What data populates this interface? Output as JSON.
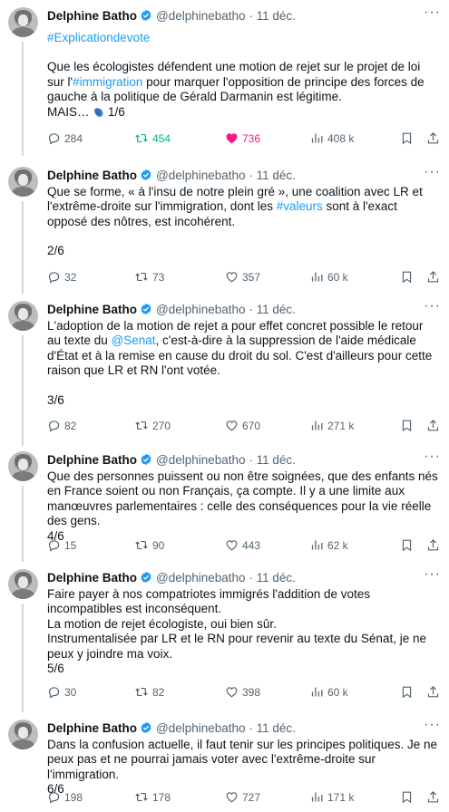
{
  "author": {
    "name": "Delphine Batho",
    "handle": "@delphinebatho",
    "date": "· 11 déc."
  },
  "colors": {
    "link": "#1d9bf0",
    "verified": "#1d9bf0",
    "retweet_active": "#00ba7c",
    "like_active": "#f91880",
    "secondary": "#536471"
  },
  "tweets": [
    {
      "hashtag": "#Explicationdevote",
      "text_a": "Que les écologistes défendent une motion de rejet sur le projet de loi sur l'",
      "link_a": "#immigration",
      "text_b": " pour marquer l'opposition de principe des forces de gauche à la politique de Gérald Darmanin est légitime.",
      "text_c": "MAIS…",
      "text_d": " 1/6",
      "replies": "284",
      "retweets": "454",
      "likes": "736",
      "views": "408 k"
    },
    {
      "text_a": "Que se forme, « à l'insu de notre plein gré », une coalition avec LR et l'extrême-droite sur l'immigration, dont les ",
      "link_a": "#valeurs",
      "text_b": " sont à l'exact opposé des nôtres, est incohérent.",
      "counter": "2/6",
      "replies": "32",
      "retweets": "73",
      "likes": "357",
      "views": "60 k"
    },
    {
      "text_a": "L'adoption de la motion de rejet a pour effet concret possible le retour au texte du ",
      "link_a": "@Senat",
      "text_b": ", c'est-à-dire à la suppression de l'aide médicale d'État et à la remise en cause du droit du sol. C'est d'ailleurs pour cette raison que LR et RN l'ont votée.",
      "counter": "3/6",
      "replies": "82",
      "retweets": "270",
      "likes": "670",
      "views": "271 k"
    },
    {
      "text_a": "Que des personnes puissent ou non être soignées, que des enfants nés en France soient ou non Français, ça compte. Il y a une limite aux manœuvres parlementaires : celle des conséquences pour la vie réelle des gens.",
      "counter": "4/6",
      "replies": "15",
      "retweets": "90",
      "likes": "443",
      "views": "62 k"
    },
    {
      "line1": "Faire payer à nos compatriotes immigrés l'addition de votes incompatibles est inconséquent.",
      "line2": "La motion de rejet écologiste, oui bien sûr.",
      "line3": "Instrumentalisée par LR et le RN pour revenir au texte du Sénat, je ne peux y joindre ma voix.",
      "counter": "5/6",
      "replies": "30",
      "retweets": "82",
      "likes": "398",
      "views": "60 k"
    },
    {
      "text_a": "Dans la confusion actuelle, il faut tenir sur les principes politiques. Je ne peux pas et ne pourrai jamais voter avec l'extrême-droite sur l'immigration.",
      "counter": "6/6",
      "replies": "198",
      "retweets": "178",
      "likes": "727",
      "views": "171 k"
    }
  ]
}
